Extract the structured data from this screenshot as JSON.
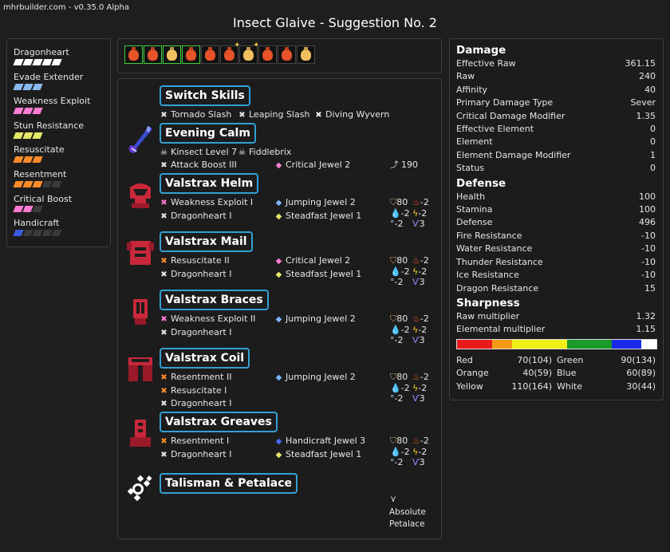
{
  "app": {
    "version": "mhrbuilder.com - v0.35.0 Alpha",
    "title": "Insect Glaive - Suggestion No. 2"
  },
  "skills": [
    {
      "name": "Dragonheart",
      "color": "#ffffff",
      "level": 5,
      "max": 5
    },
    {
      "name": "Evade Extender",
      "color": "#8ab8f0",
      "level": 3,
      "max": 3
    },
    {
      "name": "Weakness Exploit",
      "color": "#ff7bd4",
      "level": 3,
      "max": 3
    },
    {
      "name": "Stun Resistance",
      "color": "#e6e66a",
      "level": 3,
      "max": 3
    },
    {
      "name": "Resuscitate",
      "color": "#ff8c2a",
      "level": 3,
      "max": 3
    },
    {
      "name": "Resentment",
      "color": "#ff8c2a",
      "level": 3,
      "max": 5
    },
    {
      "name": "Critical Boost",
      "color": "#ff7bd4",
      "level": 2,
      "max": 3
    },
    {
      "name": "Handicraft",
      "color": "#3a5ae0",
      "level": 1,
      "max": 5
    }
  ],
  "decorations": [
    {
      "color": "#e8532a",
      "selected": true,
      "sparkle": false
    },
    {
      "color": "#e8532a",
      "selected": true,
      "sparkle": false
    },
    {
      "color": "#f0c060",
      "selected": true,
      "sparkle": false
    },
    {
      "color": "#e8532a",
      "selected": true,
      "sparkle": false
    },
    {
      "color": "#e8532a",
      "selected": false,
      "sparkle": false
    },
    {
      "color": "#e8532a",
      "selected": false,
      "sparkle": true
    },
    {
      "color": "#f0c060",
      "selected": false,
      "sparkle": true
    },
    {
      "color": "#e8532a",
      "selected": false,
      "sparkle": false
    },
    {
      "color": "#e8532a",
      "selected": false,
      "sparkle": false
    },
    {
      "color": "#f0c060",
      "selected": false,
      "sparkle": false
    }
  ],
  "switch_skills": {
    "title": "Switch Skills",
    "items": [
      "Tornado Slash",
      "Leaping Slash",
      "Diving Wyvern"
    ]
  },
  "weapon": {
    "title": "Evening Calm",
    "kinsect": "Kinsect Level 7",
    "kinsect_name": "Fiddlebrix",
    "skill": "Attack Boost III",
    "jewel": "Critical Jewel 2",
    "rampage": "190"
  },
  "armor": [
    {
      "title": "Valstrax Helm",
      "skills": [
        {
          "name": "Weakness Exploit I",
          "color": "pink"
        },
        {
          "name": "Dragonheart I",
          "color": "white"
        }
      ],
      "jewels": [
        {
          "name": "Jumping Jewel 2",
          "color": "#7ab6ff"
        },
        {
          "name": "Steadfast Jewel 1",
          "color": "#e6e66a"
        }
      ],
      "stats": {
        "defense": "80",
        "fire": "-2",
        "water": "-2",
        "thunder": "-2",
        "ice": "-2",
        "dragon": "3"
      }
    },
    {
      "title": "Valstrax Mail",
      "skills": [
        {
          "name": "Resuscitate II",
          "color": "orange"
        },
        {
          "name": "Dragonheart I",
          "color": "white"
        }
      ],
      "jewels": [
        {
          "name": "Critical Jewel 2",
          "color": "#ff7bd4"
        },
        {
          "name": "Steadfast Jewel 1",
          "color": "#e6e66a"
        }
      ],
      "stats": {
        "defense": "80",
        "fire": "-2",
        "water": "-2",
        "thunder": "-2",
        "ice": "-2",
        "dragon": "3"
      }
    },
    {
      "title": "Valstrax Braces",
      "skills": [
        {
          "name": "Weakness Exploit II",
          "color": "pink"
        },
        {
          "name": "Dragonheart I",
          "color": "white"
        }
      ],
      "jewels": [
        {
          "name": "Jumping Jewel 2",
          "color": "#7ab6ff"
        }
      ],
      "stats": {
        "defense": "80",
        "fire": "-2",
        "water": "-2",
        "thunder": "-2",
        "ice": "-2",
        "dragon": "3"
      }
    },
    {
      "title": "Valstrax Coil",
      "skills": [
        {
          "name": "Resentment II",
          "color": "orange"
        },
        {
          "name": "Resuscitate I",
          "color": "orange"
        },
        {
          "name": "Dragonheart I",
          "color": "white"
        }
      ],
      "jewels": [
        {
          "name": "Jumping Jewel 2",
          "color": "#7ab6ff"
        }
      ],
      "stats": {
        "defense": "80",
        "fire": "-2",
        "water": "-2",
        "thunder": "-2",
        "ice": "-2",
        "dragon": "3"
      }
    },
    {
      "title": "Valstrax Greaves",
      "skills": [
        {
          "name": "Resentment I",
          "color": "orange"
        },
        {
          "name": "Dragonheart I",
          "color": "white"
        }
      ],
      "jewels": [
        {
          "name": "Handicraft Jewel 3",
          "color": "#4a6aff"
        },
        {
          "name": "Steadfast Jewel 1",
          "color": "#e6e66a"
        }
      ],
      "stats": {
        "defense": "80",
        "fire": "-2",
        "water": "-2",
        "thunder": "-2",
        "ice": "-2",
        "dragon": "3"
      }
    }
  ],
  "talisman": {
    "title": "Talisman & Petalace",
    "petalace": "Absolute Petalace"
  },
  "stats": {
    "damage": {
      "title": "Damage",
      "rows": [
        {
          "label": "Effective Raw",
          "value": "361.15"
        },
        {
          "label": "Raw",
          "value": "240"
        },
        {
          "label": "Affinity",
          "value": "40"
        },
        {
          "label": "Primary Damage Type",
          "value": "Sever"
        },
        {
          "label": "Critical Damage Modifier",
          "value": "1.35"
        },
        {
          "label": "Effective Element",
          "value": "0"
        },
        {
          "label": "Element",
          "value": "0"
        },
        {
          "label": "Element Damage Modifier",
          "value": "1"
        },
        {
          "label": "Status",
          "value": "0"
        }
      ]
    },
    "defense": {
      "title": "Defense",
      "rows": [
        {
          "label": "Health",
          "value": "100"
        },
        {
          "label": "Stamina",
          "value": "100"
        },
        {
          "label": "Defense",
          "value": "496"
        },
        {
          "label": "Fire Resistance",
          "value": "-10"
        },
        {
          "label": "Water Resistance",
          "value": "-10"
        },
        {
          "label": "Thunder Resistance",
          "value": "-10"
        },
        {
          "label": "Ice Resistance",
          "value": "-10"
        },
        {
          "label": "Dragon Resistance",
          "value": "15"
        }
      ]
    },
    "sharpness": {
      "title": "Sharpness",
      "rows": [
        {
          "label": "Raw multiplier",
          "value": "1.32"
        },
        {
          "label": "Elemental multiplier",
          "value": "1.15"
        }
      ],
      "bar": [
        {
          "color": "#e81a1a",
          "value": 70
        },
        {
          "color": "#f59a16",
          "value": 40
        },
        {
          "color": "#f2ee18",
          "value": 110
        },
        {
          "color": "#1a9a2a",
          "value": 90
        },
        {
          "color": "#1a2ae8",
          "value": 60
        },
        {
          "color": "#ffffff",
          "value": 30
        }
      ],
      "bar_max": 400,
      "levels": [
        {
          "label": "Red",
          "value": "70(104)"
        },
        {
          "label": "Green",
          "value": "90(134)"
        },
        {
          "label": "Orange",
          "value": "40(59)"
        },
        {
          "label": "Blue",
          "value": "60(89)"
        },
        {
          "label": "Yellow",
          "value": "110(164)"
        },
        {
          "label": "White",
          "value": "30(44)"
        }
      ]
    }
  }
}
